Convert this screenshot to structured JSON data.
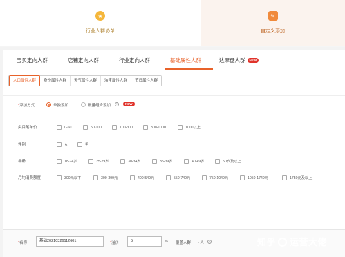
{
  "top_cards": {
    "left": {
      "label": "行业人群协单",
      "icon": "medal-icon"
    },
    "right": {
      "label": "自定义添加",
      "icon": "edit-tag-icon"
    }
  },
  "tabs": [
    {
      "label": "宝贝定向人群",
      "active": false
    },
    {
      "label": "店铺定向人群",
      "active": false
    },
    {
      "label": "行业定向人群",
      "active": false
    },
    {
      "label": "基础属性人群",
      "active": true
    },
    {
      "label": "达摩盘人群",
      "active": false,
      "badge": "NEW"
    }
  ],
  "subtabs": [
    {
      "label": "人口属性人群",
      "active": true
    },
    {
      "label": "身份属性人群",
      "active": false
    },
    {
      "label": "天气属性人群",
      "active": false
    },
    {
      "label": "淘宝属性人群",
      "active": false
    },
    {
      "label": "节日属性人群",
      "active": false
    }
  ],
  "add_method": {
    "label": "添加方式",
    "option1": "单独添加",
    "option2": "批量组合添加",
    "badge": "NEW"
  },
  "attributes": [
    {
      "label": "类目笔单价",
      "options": [
        "0-60",
        "50-100",
        "100-300",
        "300-1000",
        "1000以上"
      ]
    },
    {
      "label": "性别",
      "options": [
        "女",
        "男"
      ]
    },
    {
      "label": "年龄",
      "options": [
        "18-24岁",
        "25-29岁",
        "30-34岁",
        "35-39岁",
        "40-49岁",
        "50岁及以上"
      ]
    },
    {
      "label": "月均消费额度",
      "options": [
        "300元以下",
        "300-399元",
        "400-549元",
        "550-749元",
        "750-1049元",
        "1050-1749元",
        "1750元及以上"
      ]
    }
  ],
  "bottom": {
    "name_label": "名称：",
    "name_value": "基础20210326112601",
    "bid_label": "溢价：",
    "bid_value": "5",
    "bid_unit": "%",
    "coverage_label": "覆盖人群：",
    "coverage_value": "- 人"
  },
  "watermark": {
    "left": "知乎",
    "right": "运营大佬"
  },
  "colors": {
    "accent": "#e8622a",
    "badge": "#e0332b"
  }
}
